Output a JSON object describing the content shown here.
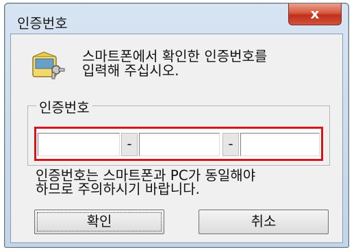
{
  "window": {
    "title": "인증번호",
    "close_glyph": "x"
  },
  "message": {
    "line1": "스마트폰에서 확인한 인증번호를",
    "line2": "입력해 주십시오.",
    "icon": "phone-key-icon"
  },
  "group": {
    "label": "인증번호",
    "separator": "-"
  },
  "code": {
    "part1": "",
    "part2": "",
    "part3": ""
  },
  "note": {
    "line1": "인증번호는 스마트폰과 PC가 동일해야",
    "line2": "하므로 주의하시기 바랍니다."
  },
  "buttons": {
    "ok": "확인",
    "cancel": "취소"
  },
  "colors": {
    "highlight": "#d8141a",
    "close": "#c7402b"
  }
}
